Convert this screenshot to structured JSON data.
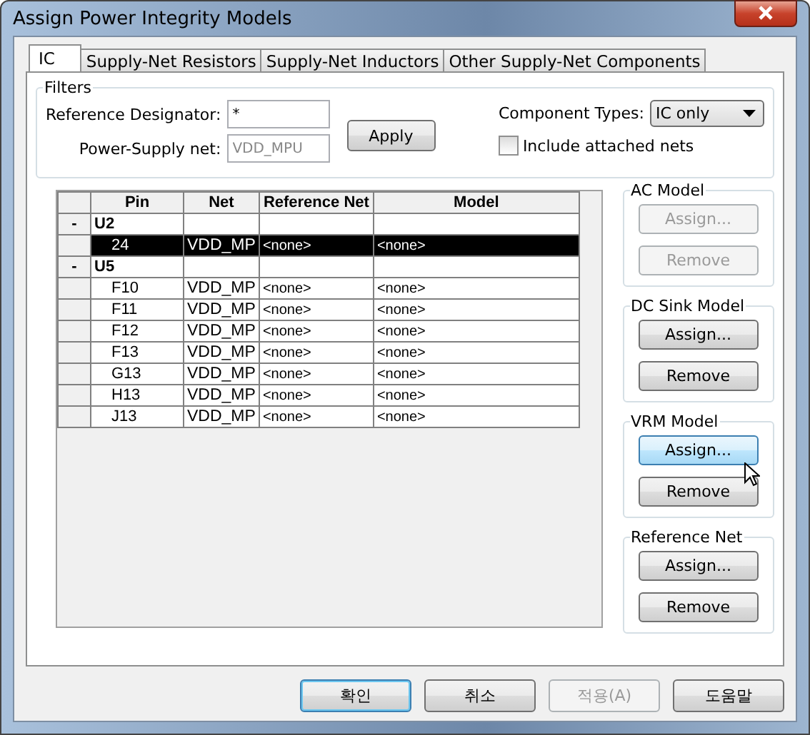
{
  "window": {
    "title": "Assign Power Integrity Models"
  },
  "tabs": [
    {
      "label": "IC",
      "selected": true
    },
    {
      "label": "Supply-Net Resistors",
      "selected": false
    },
    {
      "label": "Supply-Net Inductors",
      "selected": false
    },
    {
      "label": "Other Supply-Net Components",
      "selected": false
    }
  ],
  "filters": {
    "title": "Filters",
    "reference_designator": {
      "label": "Reference Designator:",
      "value": "*"
    },
    "power_supply_net": {
      "label": "Power-Supply net:",
      "placeholder": "VDD_MPU"
    },
    "apply_button": "Apply",
    "component_types": {
      "label": "Component Types:",
      "value": "IC only"
    },
    "include_attached_nets": {
      "label": "Include attached nets",
      "checked": false
    }
  },
  "table": {
    "columns": [
      "Pin",
      "Net",
      "Reference Net",
      "Model"
    ],
    "rows": [
      {
        "kind": "group",
        "toggle": "-",
        "name": "U2"
      },
      {
        "kind": "pin",
        "pin": "24",
        "net": "VDD_MP",
        "reference_net": "<none>",
        "model": "<none>",
        "selected": true
      },
      {
        "kind": "group",
        "toggle": "-",
        "name": "U5"
      },
      {
        "kind": "pin",
        "pin": "F10",
        "net": "VDD_MP",
        "reference_net": "<none>",
        "model": "<none>",
        "selected": false
      },
      {
        "kind": "pin",
        "pin": "F11",
        "net": "VDD_MP",
        "reference_net": "<none>",
        "model": "<none>",
        "selected": false
      },
      {
        "kind": "pin",
        "pin": "F12",
        "net": "VDD_MP",
        "reference_net": "<none>",
        "model": "<none>",
        "selected": false
      },
      {
        "kind": "pin",
        "pin": "F13",
        "net": "VDD_MP",
        "reference_net": "<none>",
        "model": "<none>",
        "selected": false
      },
      {
        "kind": "pin",
        "pin": "G13",
        "net": "VDD_MP",
        "reference_net": "<none>",
        "model": "<none>",
        "selected": false
      },
      {
        "kind": "pin",
        "pin": "H13",
        "net": "VDD_MP",
        "reference_net": "<none>",
        "model": "<none>",
        "selected": false
      },
      {
        "kind": "pin",
        "pin": "J13",
        "net": "VDD_MP",
        "reference_net": "<none>",
        "model": "<none>",
        "selected": false
      }
    ]
  },
  "model_groups": [
    {
      "title": "AC Model",
      "buttons": [
        {
          "label": "Assign...",
          "disabled": true,
          "hovered": false
        },
        {
          "label": "Remove",
          "disabled": true,
          "hovered": false
        }
      ]
    },
    {
      "title": "DC Sink Model",
      "buttons": [
        {
          "label": "Assign...",
          "disabled": false,
          "hovered": false
        },
        {
          "label": "Remove",
          "disabled": false,
          "hovered": false
        }
      ]
    },
    {
      "title": "VRM Model",
      "buttons": [
        {
          "label": "Assign...",
          "disabled": false,
          "hovered": true
        },
        {
          "label": "Remove",
          "disabled": false,
          "hovered": false
        }
      ]
    },
    {
      "title": "Reference Net",
      "buttons": [
        {
          "label": "Assign...",
          "disabled": false,
          "hovered": false
        },
        {
          "label": "Remove",
          "disabled": false,
          "hovered": false
        }
      ]
    }
  ],
  "footer_buttons": [
    {
      "label": "확인",
      "disabled": false,
      "default": true
    },
    {
      "label": "취소",
      "disabled": false,
      "default": false
    },
    {
      "label": "적용(A)",
      "disabled": true,
      "default": false
    },
    {
      "label": "도움말",
      "disabled": false,
      "default": false
    }
  ]
}
